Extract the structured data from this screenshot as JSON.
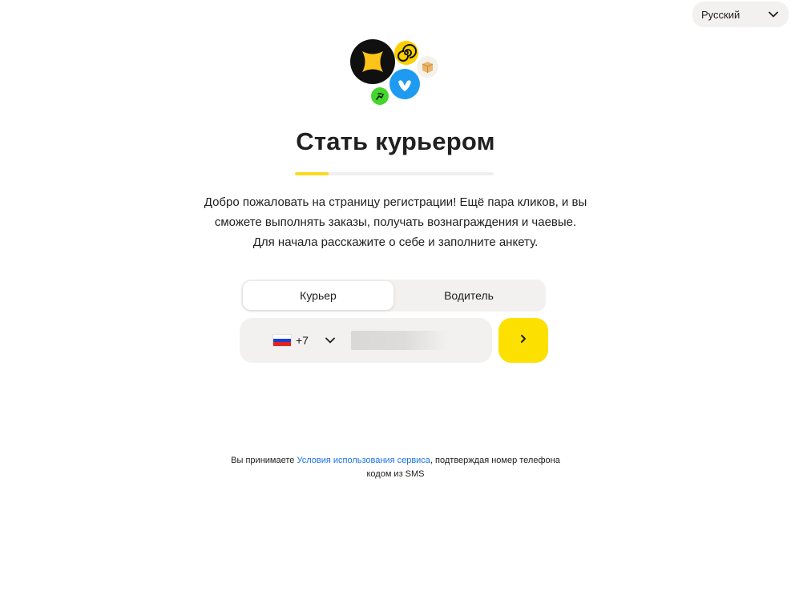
{
  "language": {
    "selected": "Русский"
  },
  "header": {
    "title": "Стать курьером"
  },
  "progress": {
    "fraction": 0.17
  },
  "intro": {
    "lines": [
      "Добро пожаловать на страницу регистрации! Ещё пара кликов, и вы",
      "сможете выполнять заказы, получать вознаграждения и чаевые.",
      "Для начала расскажите о себе и заполните анкету."
    ]
  },
  "role_switch": {
    "options": [
      "Курьер",
      "Водитель"
    ],
    "selected_index": 0
  },
  "phone": {
    "country_code": "+7",
    "flag": "russia-flag-icon",
    "value": ""
  },
  "terms": {
    "prefix": "Вы принимаете ",
    "link": "Условия использования сервиса",
    "suffix": ", подтверждая номер телефона",
    "line2": "кодом из SMS"
  },
  "colors": {
    "accent": "#fce000",
    "progress": "#fcd91f",
    "link": "#1a73e8",
    "surface": "#f2f1ef"
  },
  "icons": {
    "language_chevron": "chevron-down-icon",
    "country_chevron": "chevron-down-icon",
    "next": "chevron-right-icon"
  }
}
